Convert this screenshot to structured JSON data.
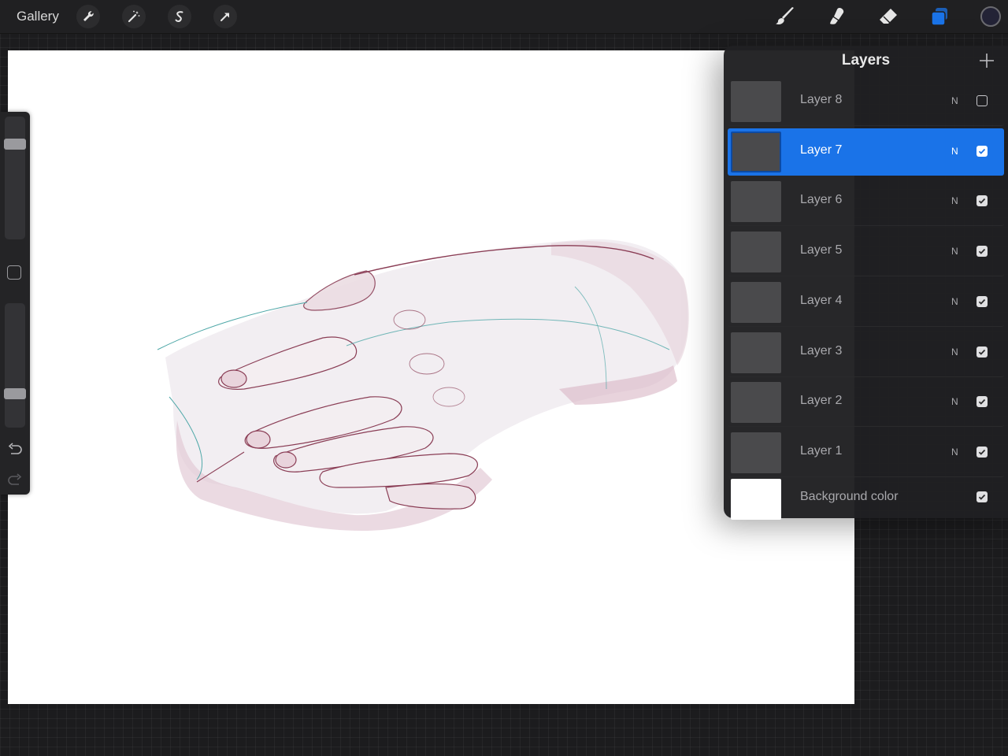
{
  "toolbar": {
    "gallery_label": "Gallery",
    "left_tools": [
      "wrench-icon",
      "magic-wand-icon",
      "selection-icon",
      "transform-arrow-icon"
    ],
    "right_tools": [
      "brush-icon",
      "smudge-icon",
      "eraser-icon",
      "layers-icon"
    ],
    "active_tool": "layers-icon",
    "accent_color": "#1a73e8",
    "current_color": "#232336"
  },
  "sidebar": {
    "brush_size_level": 0.8,
    "opacity_level": 0.25,
    "icons": [
      "modify-square-icon",
      "undo-icon",
      "redo-icon"
    ]
  },
  "layers_panel": {
    "title": "Layers",
    "add_icon": "plus-icon",
    "layers": [
      {
        "name": "Layer 8",
        "blend": "N",
        "visible": false,
        "selected": false
      },
      {
        "name": "Layer 7",
        "blend": "N",
        "visible": true,
        "selected": true
      },
      {
        "name": "Layer 6",
        "blend": "N",
        "visible": true,
        "selected": false
      },
      {
        "name": "Layer 5",
        "blend": "N",
        "visible": true,
        "selected": false
      },
      {
        "name": "Layer 4",
        "blend": "N",
        "visible": true,
        "selected": false
      },
      {
        "name": "Layer 3",
        "blend": "N",
        "visible": true,
        "selected": false
      },
      {
        "name": "Layer 2",
        "blend": "N",
        "visible": true,
        "selected": false
      },
      {
        "name": "Layer 1",
        "blend": "N",
        "visible": true,
        "selected": false
      }
    ],
    "background": {
      "name": "Background color",
      "color": "#ffffff",
      "visible": true
    }
  },
  "canvas": {
    "content": "hand-sketch",
    "sketch_colors": [
      "#8a3d55",
      "#4fa8a8"
    ]
  }
}
